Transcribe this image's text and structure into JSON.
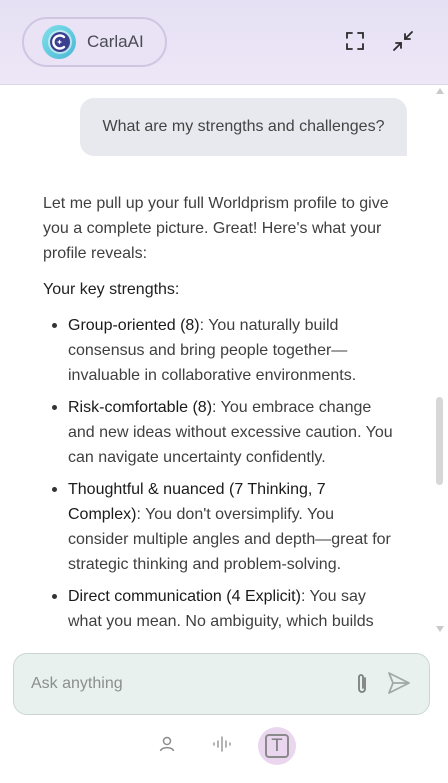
{
  "header": {
    "brand_name": "CarlaAI",
    "expand_icon": "expand-icon",
    "collapse_icon": "collapse-icon"
  },
  "chat": {
    "user_message": "What are my strengths and challenges?",
    "reply": {
      "intro": "Let me pull up your full Worldprism profile to give you a complete picture. Great! Here's what your profile reveals:",
      "heading": "Your key strengths:",
      "items": [
        {
          "title": "Group-oriented (8)",
          "text": ": You naturally build consensus and bring people together—invaluable in collaborative environments."
        },
        {
          "title": "Risk-comfortable (8)",
          "text": ": You embrace change and new ideas without excessive caution. You can navigate uncertainty confidently."
        },
        {
          "title": "Thoughtful & nuanced (7 Thinking, 7 Complex)",
          "text": ": You don't oversimplify. You consider multiple angles and depth—great for strategic thinking and problem-solving."
        },
        {
          "title": "Direct communication (4 Explicit)",
          "text": ": You say what you mean. No ambiguity, which builds"
        }
      ]
    }
  },
  "input": {
    "placeholder": "Ask anything",
    "attach_icon": "paperclip-icon",
    "send_icon": "send-icon"
  },
  "bottom_nav": {
    "items": [
      "profile-icon",
      "voice-icon",
      "text-mode-icon"
    ],
    "text_mode_glyph": "T"
  },
  "colors": {
    "header_bg": "#e9e3f5",
    "user_bubble": "#e7e9ef",
    "input_bg": "#e9f1ee",
    "active_nav": "#ead7ef",
    "logo_accent": "#3b3f8f"
  }
}
